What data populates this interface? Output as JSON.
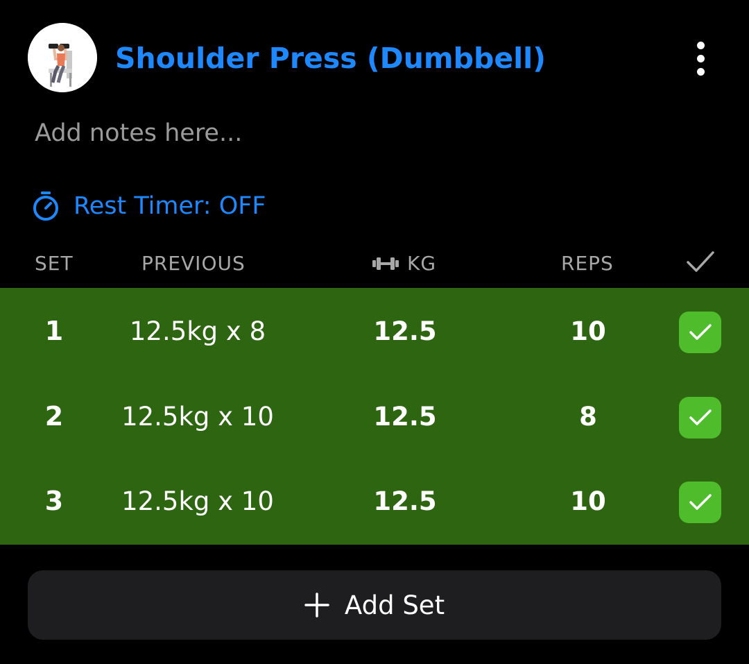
{
  "exercise": {
    "title": "Shoulder Press (Dumbbell)",
    "thumbnail_icon": "exercise-illustration",
    "menu_icon": "more-vertical-icon"
  },
  "notes": {
    "placeholder": "Add notes here...",
    "value": ""
  },
  "rest_timer": {
    "label": "Rest Timer: OFF",
    "icon": "stopwatch-icon"
  },
  "columns": {
    "set": "SET",
    "previous": "PREVIOUS",
    "kg": "KG",
    "kg_icon": "dumbbell-icon",
    "reps": "REPS",
    "done_icon": "checkmark-icon"
  },
  "sets": [
    {
      "set": "1",
      "previous": "12.5kg x 8",
      "kg": "12.5",
      "reps": "10",
      "completed": true
    },
    {
      "set": "2",
      "previous": "12.5kg x 10",
      "kg": "12.5",
      "reps": "8",
      "completed": true
    },
    {
      "set": "3",
      "previous": "12.5kg x 10",
      "kg": "12.5",
      "reps": "10",
      "completed": true
    }
  ],
  "add_set": {
    "label": "Add Set",
    "icon": "plus-icon"
  },
  "colors": {
    "accent_blue": "#1e88ff",
    "completed_row_bg": "#2d6511",
    "check_button_bg": "#4fbd2b",
    "background": "#000000",
    "button_bg": "#1e1e20"
  }
}
